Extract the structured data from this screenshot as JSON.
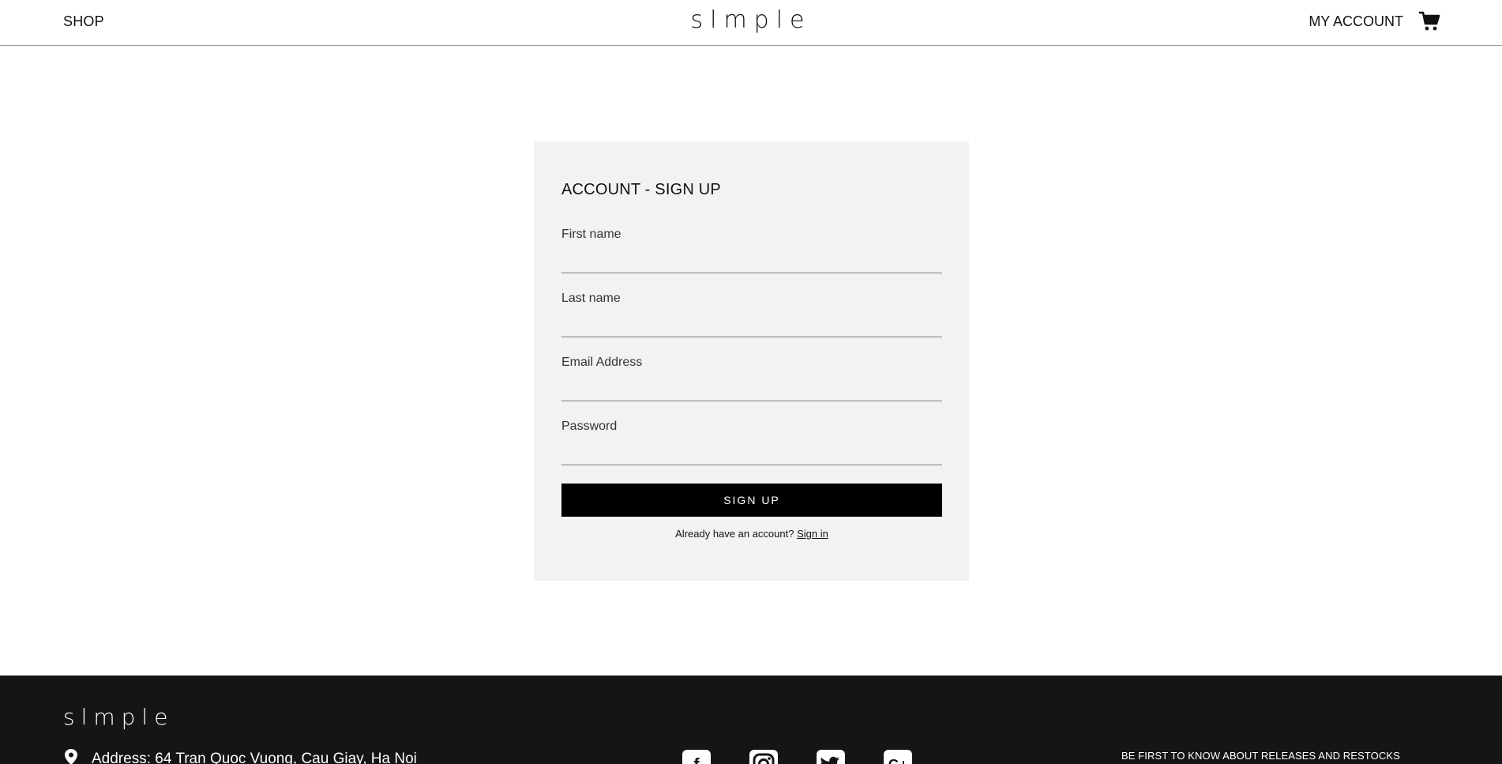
{
  "header": {
    "shop_label": "SHOP",
    "logo": "slmple",
    "account_label": "MY ACCOUNT",
    "cart_icon": "cart-icon"
  },
  "signup": {
    "title": "ACCOUNT - SIGN UP",
    "fields": [
      {
        "label": "First name",
        "value": ""
      },
      {
        "label": "Last name",
        "value": ""
      },
      {
        "label": "Email Address",
        "value": ""
      },
      {
        "label": "Password",
        "value": ""
      }
    ],
    "button_label": "SIGN UP",
    "signin_prompt": "Already have an account?",
    "signin_link": "Sign in"
  },
  "footer": {
    "logo": "slmple",
    "address": "Address: 64 Tran Quoc Vuong, Cau Giay, Ha Noi",
    "address_icon": "map-pin-icon",
    "socials": [
      "facebook-icon",
      "instagram-icon",
      "twitter-icon",
      "google-plus-icon"
    ],
    "newsletter_heading": "BE FIRST TO KNOW ABOUT RELEASES AND RESTOCKS"
  },
  "colors": {
    "card_bg": "#f2f2f2",
    "button_bg": "#000000",
    "footer_bg": "#151515"
  }
}
